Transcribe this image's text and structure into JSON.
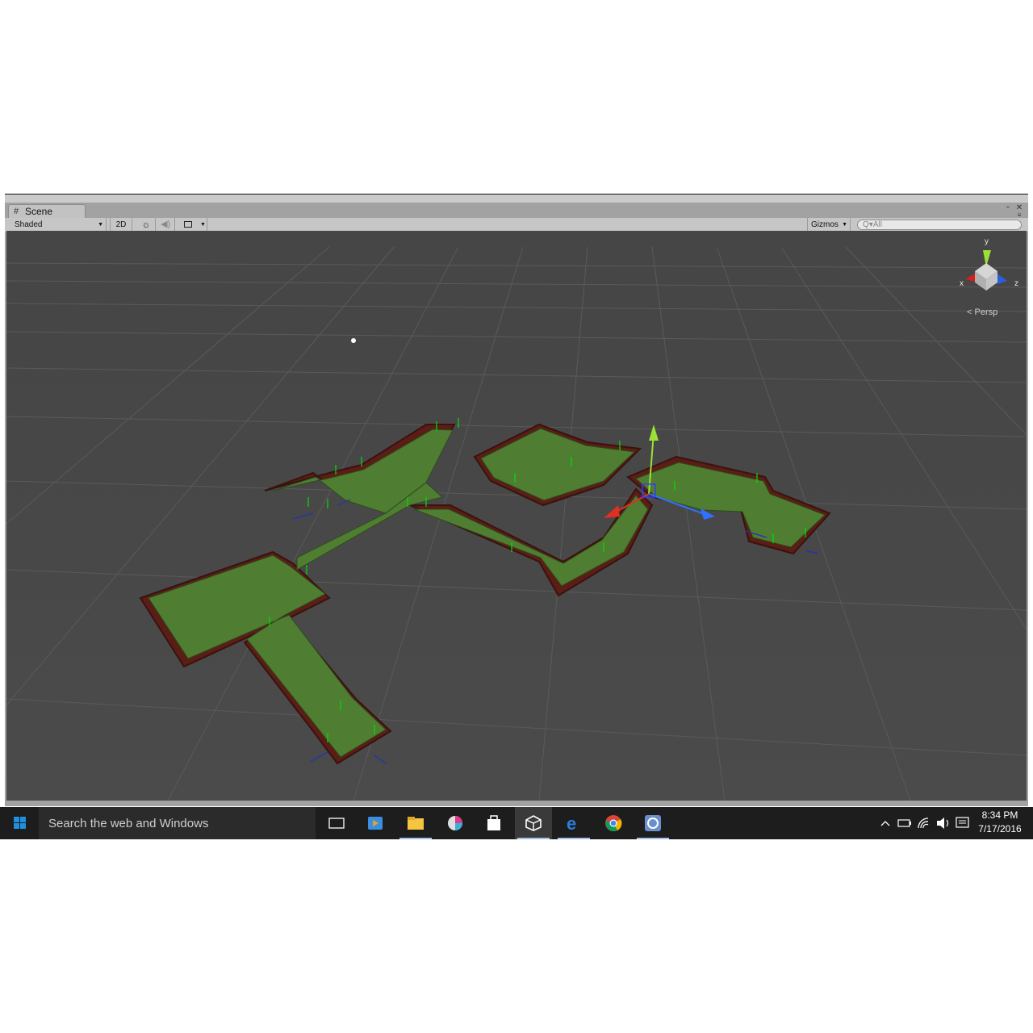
{
  "window": {
    "tab_label": "Scene",
    "shading_mode": "Shaded",
    "btn_2d": "2D",
    "gizmos_label": "Gizmos",
    "search_placeholder": "All"
  },
  "viewport": {
    "projection_label": "Persp",
    "axis_x": "x",
    "axis_y": "y",
    "axis_z": "z"
  },
  "taskbar": {
    "search_text": "Search the web and Windows",
    "apps": [
      "task-view",
      "media-player",
      "file-explorer",
      "paint-app",
      "store",
      "unity",
      "edge",
      "chrome",
      "monodevelop"
    ],
    "time": "8:34 PM",
    "date": "7/17/2016"
  },
  "colors": {
    "viewport_bg": "#474747",
    "floor_green": "#4f7d31",
    "wall_red": "#5a1e17",
    "unity_chrome": "#c6c6c6",
    "taskbar_bg": "#1d1d1d"
  }
}
